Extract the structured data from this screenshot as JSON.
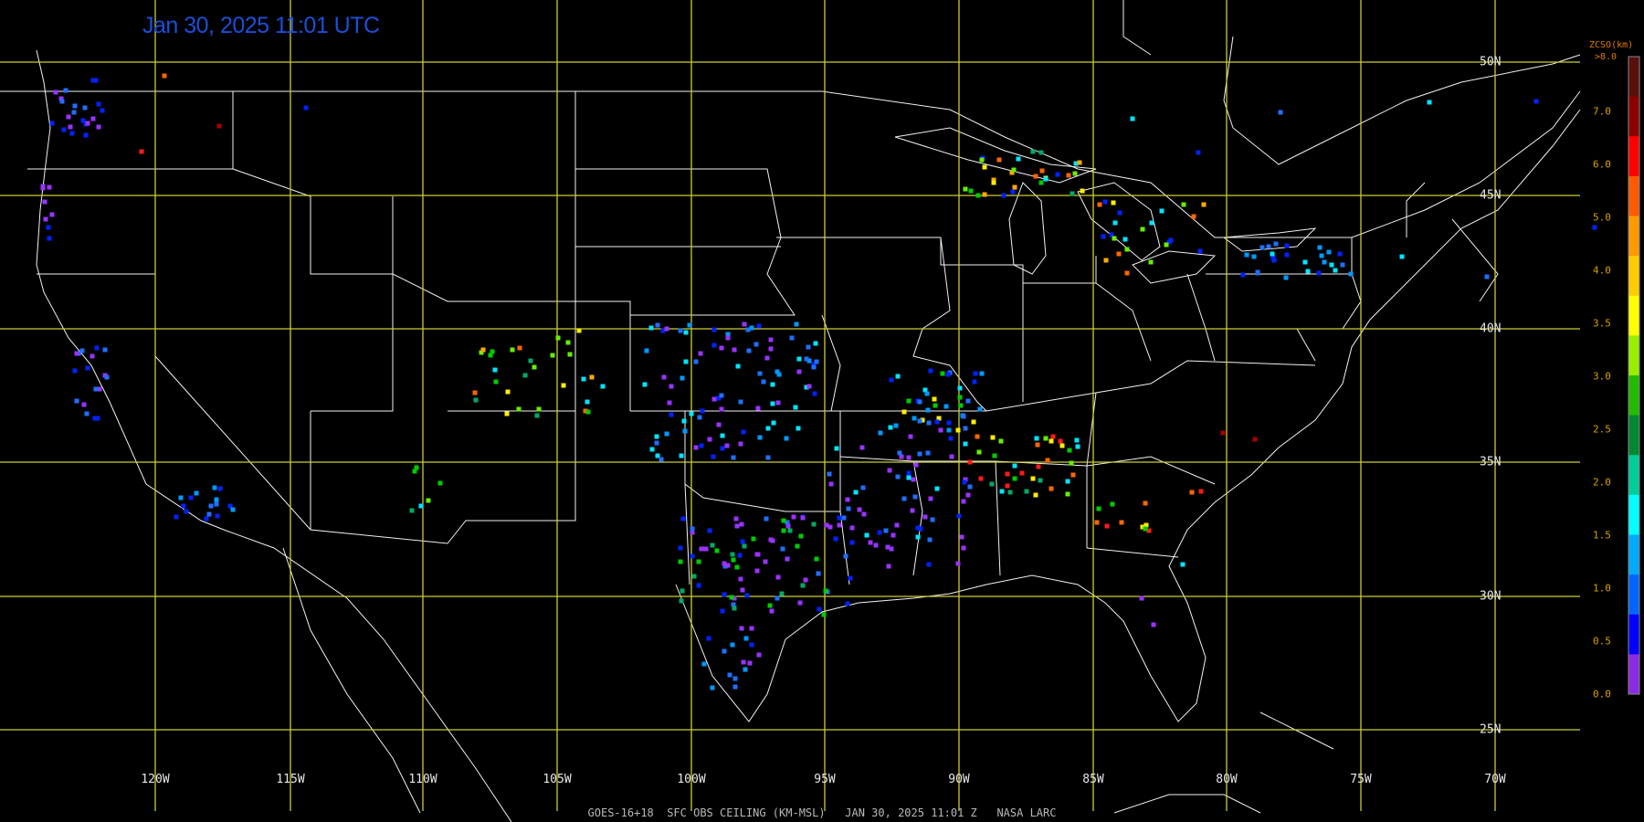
{
  "timestamp": "Jan 30, 2025 11:01 UTC",
  "footer": "GOES-16+18  SFC OBS CEILING (KM-MSL)   JAN 30, 2025 11:01 Z   NASA LARC",
  "longitude_labels": [
    "120W",
    "115W",
    "110W",
    "105W",
    "100W",
    "95W",
    "90W",
    "85W",
    "80W",
    "75W",
    "70W"
  ],
  "latitude_labels": [
    "50N",
    "45N",
    "40N",
    "35N",
    "30N",
    "25N"
  ],
  "colorbar": {
    "title": "ZCSO(km)",
    "top_label": ">8.0",
    "labels": [
      "7.0",
      "6.0",
      "5.0",
      "4.0",
      "3.5",
      "3.0",
      "2.5",
      "2.0",
      "1.5",
      "1.0",
      "0.5",
      "0.0"
    ],
    "colors": [
      "#5a0f0f",
      "#8b0000",
      "#ff0000",
      "#ff5a00",
      "#ff9900",
      "#ffcc00",
      "#ffff00",
      "#99ee00",
      "#22bb00",
      "#008833",
      "#00cc99",
      "#00ffff",
      "#00aaff",
      "#0066ff",
      "#0000ff",
      "#8a2be2"
    ]
  },
  "station_colors": {
    "purple": "#9933ff",
    "blue": "#0022ff",
    "mblue": "#1f6fff",
    "lblue": "#0099ff",
    "cyan": "#00e5ff",
    "teal": "#00aa66",
    "green": "#00cc00",
    "lgreen": "#66ee00",
    "yellow": "#ffee00",
    "gold": "#ffaa00",
    "orange": "#ff6600",
    "red": "#ff1a1a",
    "dred": "#aa0000"
  }
}
